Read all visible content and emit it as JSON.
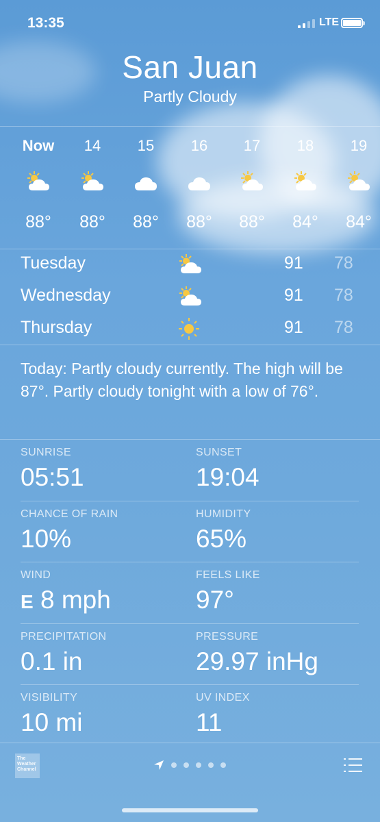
{
  "status_bar": {
    "time": "13:35",
    "network": "LTE"
  },
  "location": {
    "city": "San Juan",
    "condition": "Partly Cloudy"
  },
  "hourly": [
    {
      "label": "Now",
      "temp": "88°",
      "icon": "partly-cloudy-sun-icon"
    },
    {
      "label": "14",
      "temp": "88°",
      "icon": "partly-cloudy-sun-icon"
    },
    {
      "label": "15",
      "temp": "88°",
      "icon": "cloud-icon"
    },
    {
      "label": "16",
      "temp": "88°",
      "icon": "cloud-icon"
    },
    {
      "label": "17",
      "temp": "88°",
      "icon": "partly-cloudy-sun-icon"
    },
    {
      "label": "18",
      "temp": "84°",
      "icon": "partly-cloudy-sun-icon"
    },
    {
      "label": "19",
      "temp": "84°",
      "icon": "partly-cloudy-sun-icon"
    }
  ],
  "daily": [
    {
      "day": "Tuesday",
      "icon": "partly-cloudy-sun-icon",
      "high": "91",
      "low": "78"
    },
    {
      "day": "Wednesday",
      "icon": "partly-cloudy-sun-icon",
      "high": "91",
      "low": "78"
    },
    {
      "day": "Thursday",
      "icon": "sun-icon",
      "high": "91",
      "low": "78"
    }
  ],
  "summary": "Today: Partly cloudy currently. The high will be 87°. Partly cloudy tonight with a low of 76°.",
  "details": {
    "sunrise": {
      "label": "SUNRISE",
      "value": "05:51"
    },
    "sunset": {
      "label": "SUNSET",
      "value": "19:04"
    },
    "chance_of_rain": {
      "label": "CHANCE OF RAIN",
      "value": "10%"
    },
    "humidity": {
      "label": "HUMIDITY",
      "value": "65%"
    },
    "wind": {
      "label": "WIND",
      "direction": "E",
      "value": "8 mph"
    },
    "feels_like": {
      "label": "FEELS LIKE",
      "value": "97°"
    },
    "precipitation": {
      "label": "PRECIPITATION",
      "value": "0.1 in"
    },
    "pressure": {
      "label": "PRESSURE",
      "value": "29.97 inHg"
    },
    "visibility": {
      "label": "VISIBILITY",
      "value": "10 mi"
    },
    "uv_index": {
      "label": "UV INDEX",
      "value": "11"
    }
  },
  "footer": {
    "logo_text": "The Weather Channel",
    "page_count": 5
  },
  "colors": {
    "sun": "#f7c843",
    "sky_top": "#5b9bd6",
    "sky_bottom": "#78b0de"
  }
}
